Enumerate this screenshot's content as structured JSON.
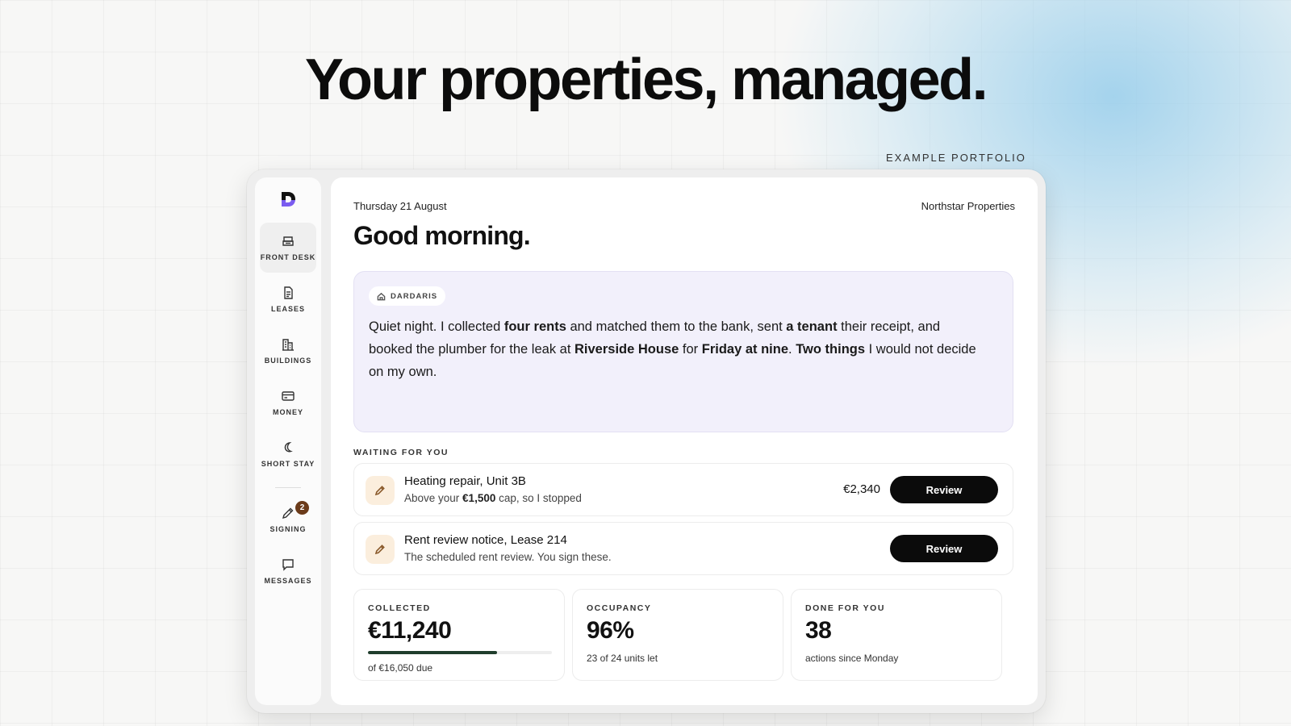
{
  "hero": {
    "headline": "Your properties, managed.",
    "example_label": "EXAMPLE PORTFOLIO"
  },
  "colors": {
    "accent_logo": "#7b5cf0",
    "progress": "#1f3d2c",
    "agent_card_bg": "#f2f0fb",
    "task_icon_bg": "#fbeedd",
    "badge_bg": "#6b3b1a"
  },
  "sidebar": {
    "items": [
      {
        "label": "FRONT DESK",
        "icon": "inbox-tray-icon",
        "active": true
      },
      {
        "label": "LEASES",
        "icon": "document-icon"
      },
      {
        "label": "BUILDINGS",
        "icon": "buildings-icon"
      },
      {
        "label": "MONEY",
        "icon": "credit-card-icon"
      },
      {
        "label": "SHORT STAY",
        "icon": "moon-icon"
      },
      {
        "label": "SIGNING",
        "icon": "pen-icon",
        "badge": "2"
      },
      {
        "label": "MESSAGES",
        "icon": "chat-bubble-icon"
      }
    ]
  },
  "header": {
    "date": "Thursday 21 August",
    "company": "Northstar Properties",
    "greeting": "Good morning."
  },
  "agent": {
    "name": "DARDARIS",
    "message_parts": [
      {
        "t": "Quiet night. I collected "
      },
      {
        "t": "four rents",
        "b": true
      },
      {
        "t": " and matched them to the bank, sent "
      },
      {
        "t": "a tenant",
        "b": true
      },
      {
        "t": " their receipt, and booked the plumber for the leak at "
      },
      {
        "t": "Riverside House",
        "b": true
      },
      {
        "t": " for "
      },
      {
        "t": "Friday at nine",
        "b": true
      },
      {
        "t": ". "
      },
      {
        "t": "Two things",
        "b": true
      },
      {
        "t": " I would not decide on my own."
      }
    ]
  },
  "waiting": {
    "label": "WAITING FOR YOU",
    "tasks": [
      {
        "title": "Heating repair, Unit 3B",
        "sub_before": "Above your ",
        "sub_bold": "€1,500",
        "sub_after": " cap, so I stopped",
        "amount": "€2,340",
        "button": "Review"
      },
      {
        "title": "Rent review notice, Lease 214",
        "sub_before": "The scheduled rent review. You sign these.",
        "sub_bold": "",
        "sub_after": "",
        "amount": "",
        "button": "Review"
      }
    ]
  },
  "stats": {
    "collected": {
      "label": "COLLECTED",
      "value": "€11,240",
      "sub": "of €16,050 due",
      "progress": 0.7
    },
    "occupancy": {
      "label": "OCCUPANCY",
      "value": "96%",
      "sub": "23 of 24 units let"
    },
    "done": {
      "label": "DONE FOR YOU",
      "value": "38",
      "sub": "actions since Monday"
    }
  }
}
